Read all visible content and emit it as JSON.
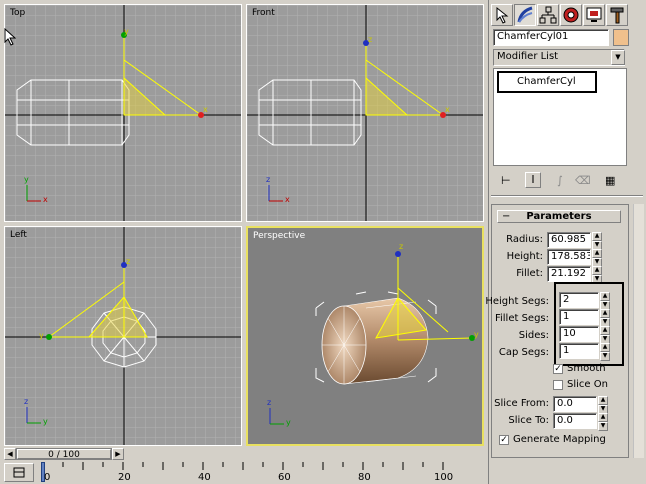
{
  "viewports": {
    "top": {
      "label": "Top"
    },
    "front": {
      "label": "Front"
    },
    "left": {
      "label": "Left"
    },
    "perspective": {
      "label": "Perspective"
    }
  },
  "axis_letters": {
    "x": "x",
    "y": "y",
    "z": "z"
  },
  "command_tabs": [
    {
      "icon": "create-arrow-icon"
    },
    {
      "icon": "modify-icon"
    },
    {
      "icon": "hierarchy-icon"
    },
    {
      "icon": "motion-icon"
    },
    {
      "icon": "display-icon"
    },
    {
      "icon": "utilities-hammer-icon"
    }
  ],
  "object": {
    "name": "ChamferCyl01",
    "color": "#f0c08c"
  },
  "modifier_list": {
    "label": "Modifier List",
    "stack_item": "ChamferCyl"
  },
  "parameters": {
    "title": "Parameters",
    "radius": {
      "label": "Radius:",
      "value": "60.985"
    },
    "height": {
      "label": "Height:",
      "value": "178.583"
    },
    "fillet": {
      "label": "Fillet:",
      "value": "21.192"
    },
    "height_segs": {
      "label": "Height Segs:",
      "value": "2"
    },
    "fillet_segs": {
      "label": "Fillet Segs:",
      "value": "1"
    },
    "sides": {
      "label": "Sides:",
      "value": "10"
    },
    "cap_segs": {
      "label": "Cap Segs:",
      "value": "1"
    },
    "smooth": {
      "label": "Smooth",
      "checked": true
    },
    "slice_on": {
      "label": "Slice On",
      "checked": false
    },
    "slice_from": {
      "label": "Slice From:",
      "value": "0.0"
    },
    "slice_to": {
      "label": "Slice To:",
      "value": "0.0"
    },
    "generate_mapping": {
      "label": "Generate Mapping",
      "checked": true
    }
  },
  "timeline": {
    "frame_display": "0 / 100",
    "ticks": [
      "0",
      "20",
      "40",
      "60",
      "80",
      "100"
    ]
  },
  "colors": {
    "highlight": "#ffff00",
    "viewport_bg": "#9c9c9c",
    "active_border": "#e8e060"
  }
}
